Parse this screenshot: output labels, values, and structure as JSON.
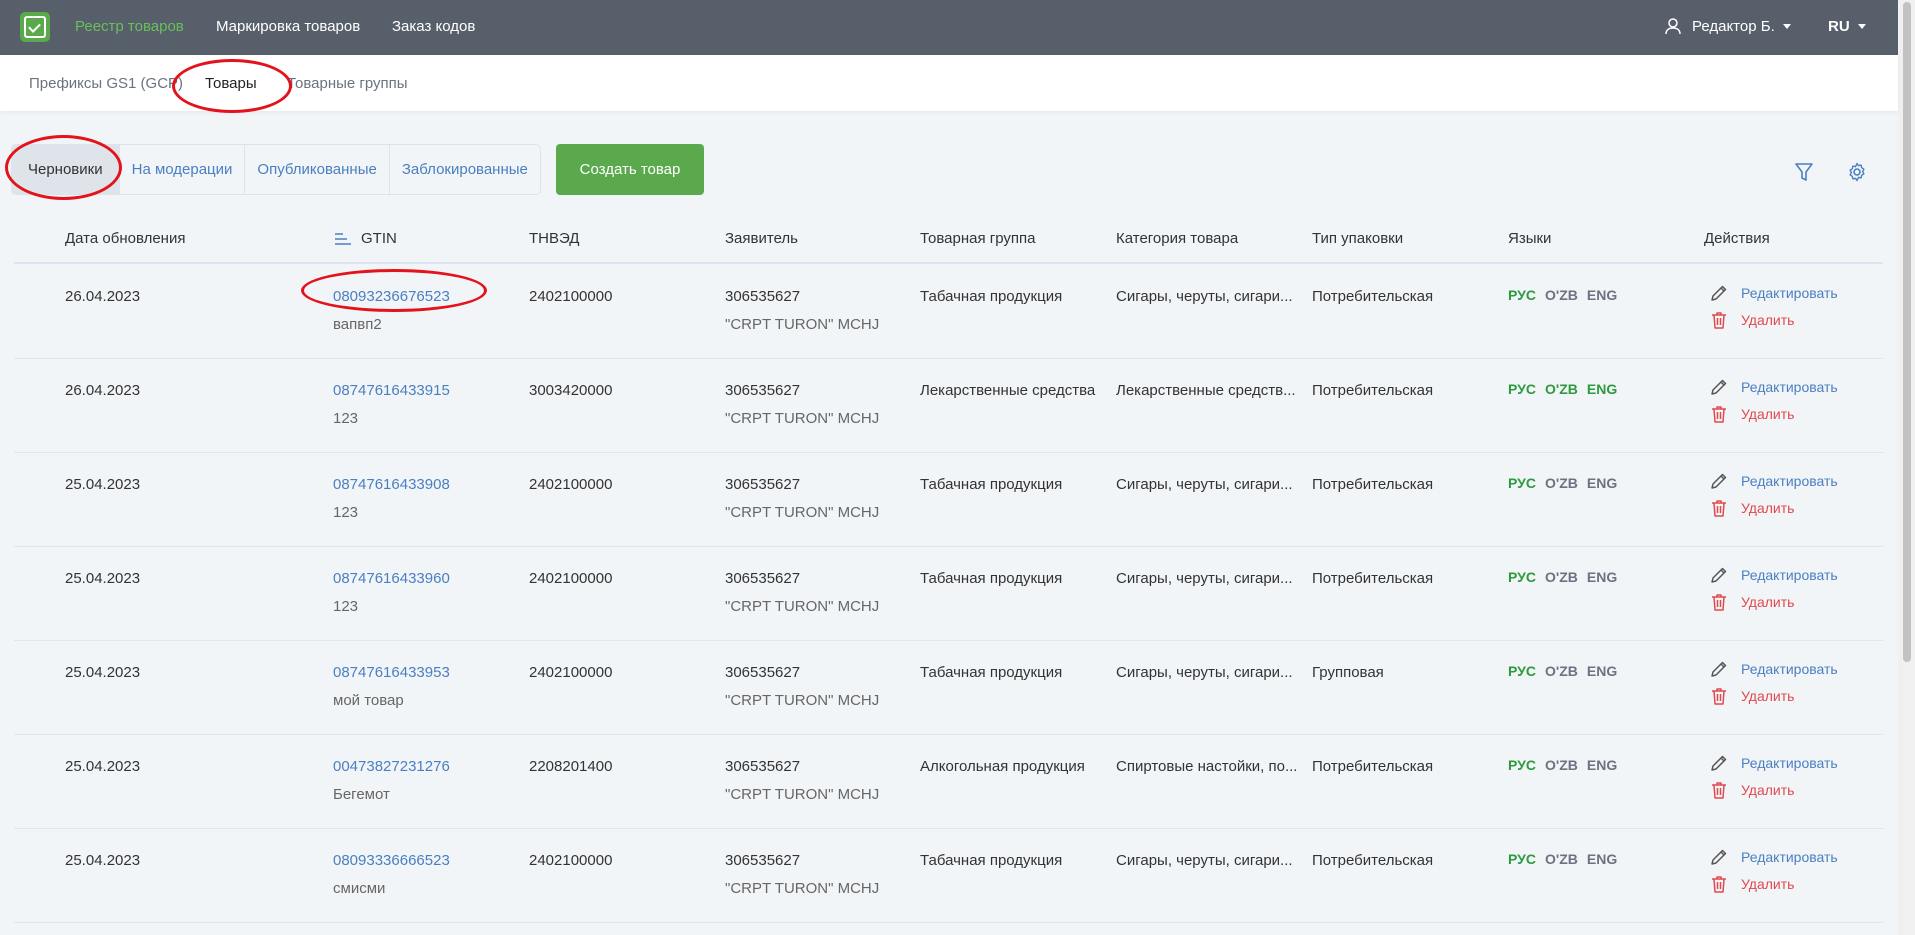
{
  "topnav": {
    "items": [
      {
        "label": "Реестр товаров"
      },
      {
        "label": "Маркировка товаров"
      },
      {
        "label": "Заказ кодов"
      }
    ],
    "user": "Редактор Б.",
    "lang": "RU"
  },
  "subnav": {
    "tabs": [
      {
        "label": "Префиксы GS1 (GCP)"
      },
      {
        "label": "Товары"
      },
      {
        "label": "Товарные группы"
      }
    ]
  },
  "status_tabs": [
    {
      "label": "Черновики"
    },
    {
      "label": "На модерации"
    },
    {
      "label": "Опубликованные"
    },
    {
      "label": "Заблокированные"
    }
  ],
  "create_button": "Создать товар",
  "table": {
    "headers": [
      "Дата обновления",
      "GTIN",
      "ТНВЭД",
      "Заявитель",
      "Товарная группа",
      "Категория товара",
      "Тип упаковки",
      "Языки",
      "Действия"
    ],
    "edit_label": "Редактировать",
    "delete_label": "Удалить",
    "lang_labels": [
      "РУС",
      "O'ZB",
      "ENG"
    ],
    "rows": [
      {
        "date": "26.04.2023",
        "gtin": "08093236676523",
        "name": "вапвп2",
        "tnved": "2402100000",
        "applicant_id": "306535627",
        "applicant_name": "\"CRPT TURON\" MCHJ",
        "group": "Табачная продукция",
        "category": "Сигары, черуты, сигари...",
        "package": "Потребительская",
        "langs_active": [
          true,
          false,
          false
        ]
      },
      {
        "date": "26.04.2023",
        "gtin": "08747616433915",
        "name": "123",
        "tnved": "3003420000",
        "applicant_id": "306535627",
        "applicant_name": "\"CRPT TURON\" MCHJ",
        "group": "Лекарственные средства",
        "category": "Лекарственные средств...",
        "package": "Потребительская",
        "langs_active": [
          true,
          true,
          true
        ]
      },
      {
        "date": "25.04.2023",
        "gtin": "08747616433908",
        "name": "123",
        "tnved": "2402100000",
        "applicant_id": "306535627",
        "applicant_name": "\"CRPT TURON\" MCHJ",
        "group": "Табачная продукция",
        "category": "Сигары, черуты, сигари...",
        "package": "Потребительская",
        "langs_active": [
          true,
          false,
          false
        ]
      },
      {
        "date": "25.04.2023",
        "gtin": "08747616433960",
        "name": "123",
        "tnved": "2402100000",
        "applicant_id": "306535627",
        "applicant_name": "\"CRPT TURON\" MCHJ",
        "group": "Табачная продукция",
        "category": "Сигары, черуты, сигари...",
        "package": "Потребительская",
        "langs_active": [
          true,
          false,
          false
        ]
      },
      {
        "date": "25.04.2023",
        "gtin": "08747616433953",
        "name": "мой товар",
        "tnved": "2402100000",
        "applicant_id": "306535627",
        "applicant_name": "\"CRPT TURON\" MCHJ",
        "group": "Табачная продукция",
        "category": "Сигары, черуты, сигари...",
        "package": "Групповая",
        "langs_active": [
          true,
          false,
          false
        ]
      },
      {
        "date": "25.04.2023",
        "gtin": "00473827231276",
        "name": "Бегемот",
        "tnved": "2208201400",
        "applicant_id": "306535627",
        "applicant_name": "\"CRPT TURON\" MCHJ",
        "group": "Алкогольная продукция",
        "category": "Спиртовые настойки, по...",
        "package": "Потребительская",
        "langs_active": [
          true,
          false,
          false
        ]
      },
      {
        "date": "25.04.2023",
        "gtin": "08093336666523",
        "name": "смисми",
        "tnved": "2402100000",
        "applicant_id": "306535627",
        "applicant_name": "\"CRPT TURON\" MCHJ",
        "group": "Табачная продукция",
        "category": "Сигары, черуты, сигари...",
        "package": "Потребительская",
        "langs_active": [
          true,
          false,
          false
        ]
      }
    ]
  },
  "icons": {
    "filter": "filter-icon",
    "settings": "gear-icon",
    "edit": "pencil-icon",
    "delete": "trash-icon",
    "user": "user-icon"
  },
  "colors": {
    "topbar": "#575f6a",
    "accent_green": "#5aaa4d",
    "link_blue": "#4a7fc1",
    "danger_red": "#e0494d",
    "annotation_red": "#e4121b"
  }
}
